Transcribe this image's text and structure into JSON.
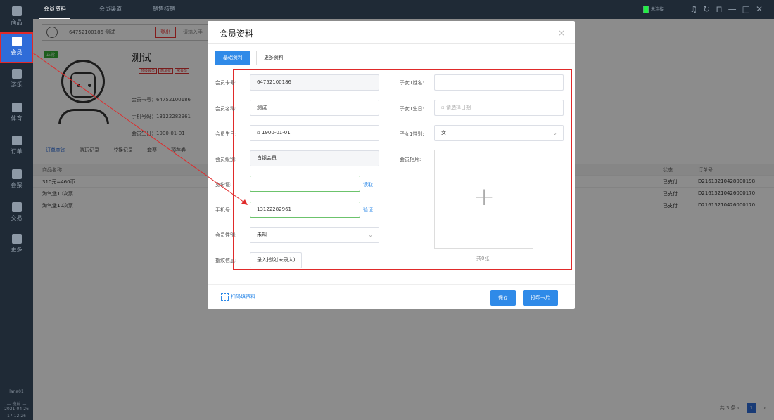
{
  "sidebar": {
    "items": [
      {
        "label": "商品"
      },
      {
        "label": "会员"
      },
      {
        "label": "游乐"
      },
      {
        "label": "体育"
      },
      {
        "label": "订单"
      },
      {
        "label": "套票"
      },
      {
        "label": "交易"
      },
      {
        "label": "更多"
      }
    ],
    "user": "lana01",
    "shift": "— 班前 —",
    "date": "2021-04-26",
    "time": "17:12:26"
  },
  "topbar": {
    "tabs": [
      "会员资料",
      "会员渠道",
      "销售核销"
    ],
    "mini_label": "未连接"
  },
  "background": {
    "member_id": "64752100186",
    "member_short": "测试",
    "logout_label": "登出",
    "search_hint": "请输入手",
    "status_tag": "正常",
    "member_name": "测试",
    "tags": [
      "顶级会员",
      "高消费",
      "常会员"
    ],
    "card_line": "会员卡号：64752100186",
    "phone_line": "手机号码：13122282961",
    "birthday_line": "会员生日：1900-01-01",
    "subtabs": [
      "订单查询",
      "游玩记录",
      "兑换记录",
      "套票",
      "预存券"
    ],
    "table": {
      "headers": {
        "name": "商品名称",
        "status": "状态",
        "order": "订单号"
      },
      "rows": [
        {
          "name": "310元=460币",
          "status": "已支付",
          "order": "D216132104280001​98"
        },
        {
          "name": "淘气堡10次票",
          "status": "已支付",
          "order": "D216132104260001​70"
        },
        {
          "name": "淘气堡10次票",
          "status": "已支付",
          "order": "D216132104260001​70"
        }
      ]
    },
    "pager": {
      "total": "共 3 条",
      "page": "1",
      "prev": "‹",
      "next": "›"
    }
  },
  "modal": {
    "title": "会员资料",
    "close": "×",
    "tabs": [
      "基础资料",
      "更多资料"
    ],
    "fields": {
      "card_no": {
        "label": "会员卡号:",
        "value": "64752100186"
      },
      "name": {
        "label": "会员名称:",
        "value": "测试"
      },
      "birthday": {
        "label": "会员生日:",
        "value": "1900-01-01"
      },
      "level": {
        "label": "会员级别:",
        "value": "白银会员"
      },
      "id_card": {
        "label": "身份证:",
        "value": "",
        "action": "读取"
      },
      "phone": {
        "label": "手机号:",
        "value": "13122282961",
        "action": "验证"
      },
      "gender": {
        "label": "会员性别:",
        "value": "未知"
      },
      "fingerprint": {
        "label": "指纹信息:",
        "button": "录入指纹(未录入)"
      },
      "child_name": {
        "label": "子女1姓名:",
        "value": ""
      },
      "child_birthday": {
        "label": "子女1生日:",
        "placeholder": "请选择日期"
      },
      "child_gender": {
        "label": "子女1性别:",
        "value": "女"
      },
      "photo": {
        "label": "会员相片:",
        "count": "共0张"
      }
    },
    "footer": {
      "scan_label": "扫码填资料",
      "save_label": "保存",
      "print_label": "打印卡片"
    }
  },
  "colors": {
    "accent": "#2f8ae8",
    "sidebar": "#1f2a36",
    "highlight": "#e02a2a"
  }
}
